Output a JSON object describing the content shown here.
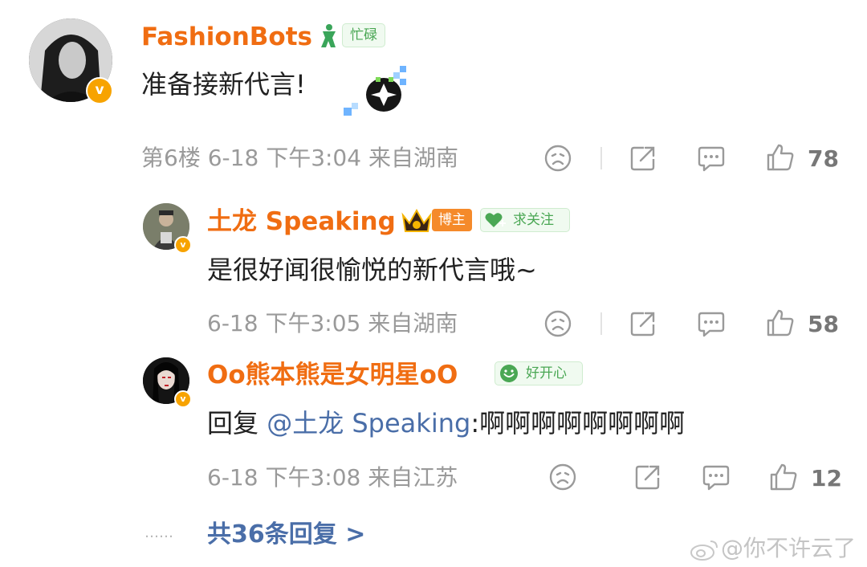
{
  "comment": {
    "username": "FashionBots",
    "badge_label": "忙碌",
    "text": "准备接新代言!",
    "floor": "第6楼",
    "date": "6-18",
    "time": "下午3:04",
    "location": "来自湖南",
    "like_count": "78"
  },
  "replies": [
    {
      "username": "土龙 Speaking",
      "role_badge": "博主",
      "follow_label": "求关注",
      "text": "是很好闻很愉悦的新代言哦~",
      "date": "6-18",
      "time": "下午3:05",
      "location": "来自湖南",
      "like_count": "58"
    },
    {
      "username": "Oo熊本熊是女明星oO",
      "status_label": "好开心",
      "reply_prefix": "回复",
      "mention": "@土龙 Speaking",
      "text": ":啊啊啊啊啊啊啊啊",
      "date": "6-18",
      "time": "下午3:08",
      "location": "来自江苏",
      "like_count": "12"
    }
  ],
  "more_replies_dots": "……",
  "more_replies": "共36条回复 >",
  "watermark": "@你不许云了",
  "colors": {
    "username": "#f06d12",
    "link": "#4a6ea8",
    "meta": "#9a9a9a",
    "verified_badge": "#f7a300",
    "status_green": "#4aa754"
  },
  "icons": [
    "dislike-icon",
    "share-icon",
    "comment-icon",
    "like-icon",
    "verified-icon",
    "crown-icon",
    "smile-icon",
    "heart-plus-icon",
    "weibo-logo-icon"
  ]
}
